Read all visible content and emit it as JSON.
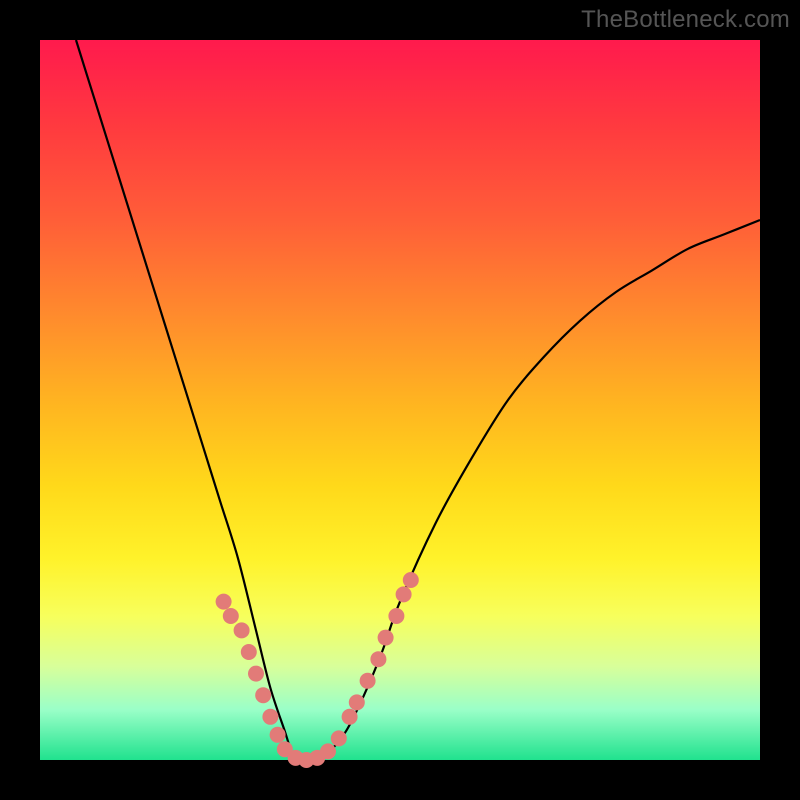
{
  "watermark": "TheBottleneck.com",
  "colors": {
    "background": "#000000",
    "curve": "#000000",
    "dot": "#e27b78",
    "gradient_top": "#ff1a4d",
    "gradient_bottom": "#20e28e"
  },
  "chart_data": {
    "type": "line",
    "title": "",
    "xlabel": "",
    "ylabel": "",
    "xlim": [
      0,
      100
    ],
    "ylim": [
      0,
      100
    ],
    "grid": false,
    "comment": "Axes unlabeled; values are relative 0–100 estimates read off the plot. y is visual height (higher = closer to red/top).",
    "series": [
      {
        "name": "curve",
        "x": [
          5,
          7.5,
          10,
          12.5,
          15,
          17.5,
          20,
          22.5,
          25,
          27.5,
          30,
          32,
          34,
          35,
          36,
          38,
          40,
          42.5,
          45,
          47.5,
          50,
          55,
          60,
          65,
          70,
          75,
          80,
          85,
          90,
          95,
          100
        ],
        "y": [
          100,
          92,
          84,
          76,
          68,
          60,
          52,
          44,
          36,
          28,
          18,
          10,
          4,
          1,
          0,
          0,
          1,
          4,
          9,
          15,
          22,
          33,
          42,
          50,
          56,
          61,
          65,
          68,
          71,
          73,
          75
        ]
      }
    ],
    "dots": {
      "comment": "Salmon markers along the lower part of both arms of the V.",
      "points": [
        {
          "x": 25.5,
          "y": 22
        },
        {
          "x": 26.5,
          "y": 20
        },
        {
          "x": 28.0,
          "y": 18
        },
        {
          "x": 29.0,
          "y": 15
        },
        {
          "x": 30.0,
          "y": 12
        },
        {
          "x": 31.0,
          "y": 9
        },
        {
          "x": 32.0,
          "y": 6
        },
        {
          "x": 33.0,
          "y": 3.5
        },
        {
          "x": 34.0,
          "y": 1.5
        },
        {
          "x": 35.5,
          "y": 0.3
        },
        {
          "x": 37.0,
          "y": 0
        },
        {
          "x": 38.5,
          "y": 0.3
        },
        {
          "x": 40.0,
          "y": 1.2
        },
        {
          "x": 41.5,
          "y": 3
        },
        {
          "x": 43.0,
          "y": 6
        },
        {
          "x": 44.0,
          "y": 8
        },
        {
          "x": 45.5,
          "y": 11
        },
        {
          "x": 47.0,
          "y": 14
        },
        {
          "x": 48.0,
          "y": 17
        },
        {
          "x": 49.5,
          "y": 20
        },
        {
          "x": 50.5,
          "y": 23
        },
        {
          "x": 51.5,
          "y": 25
        }
      ]
    }
  }
}
